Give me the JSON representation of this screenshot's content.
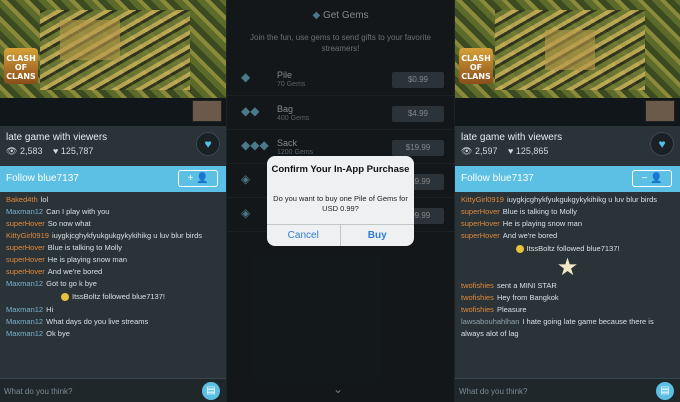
{
  "left": {
    "video_logo": [
      "CLASH",
      "OF",
      "CLANS"
    ],
    "stream_title": "late game with viewers",
    "views": "2,583",
    "likes": "125,787",
    "follow_label": "Follow blue7137",
    "follow_button": "+ 👤",
    "chat": [
      {
        "type": "msg",
        "user": "Baked4th",
        "text": "lol",
        "color": "orange"
      },
      {
        "type": "msg",
        "user": "Maxman12",
        "text": "Can I play with you",
        "color": "blue"
      },
      {
        "type": "msg",
        "user": "superHover",
        "text": "So now what",
        "color": "orange"
      },
      {
        "type": "msg",
        "user": "KittyGirl0919",
        "text": "iuygkjcghykfyukgukgykykihikg u luv blur birds",
        "color": "orange"
      },
      {
        "type": "msg",
        "user": "superHover",
        "text": "Blue is talking to Molly",
        "color": "orange"
      },
      {
        "type": "msg",
        "user": "superHover",
        "text": "He is playing snow man",
        "color": "orange"
      },
      {
        "type": "msg",
        "user": "superHover",
        "text": "And we're bored",
        "color": "orange"
      },
      {
        "type": "msg",
        "user": "Maxman12",
        "text": "Got to go k bye",
        "color": "blue"
      },
      {
        "type": "event",
        "text": "ItssBoltz followed blue7137!"
      },
      {
        "type": "msg",
        "user": "Maxman12",
        "text": "Hi",
        "color": "blue"
      },
      {
        "type": "msg",
        "user": "Maxman12",
        "text": "What days do you live streams",
        "color": "blue"
      },
      {
        "type": "msg",
        "user": "Maxman12",
        "text": "Ok bye",
        "color": "blue"
      }
    ],
    "input_placeholder": "What do you think?"
  },
  "middle": {
    "header": "Get Gems",
    "subtitle": "Join the fun, use gems to send gifts to your favorite streamers!",
    "gems": [
      {
        "name": "Pile",
        "count": "70 Gems",
        "price": "$0.99"
      },
      {
        "name": "Bag",
        "count": "400 Gems",
        "price": "$4.99"
      },
      {
        "name": "Sack",
        "count": "1200 Gems",
        "price": "$19.99"
      },
      {
        "name": "",
        "count": "",
        "price": "$39.99"
      },
      {
        "name": "",
        "count": "",
        "price": "$99.99"
      }
    ],
    "dialog": {
      "title": "Confirm Your In-App Purchase",
      "message": "Do you want to buy one Pile of Gems for USD 0.99?",
      "cancel": "Cancel",
      "buy": "Buy"
    }
  },
  "right": {
    "video_logo": [
      "CLASH",
      "OF",
      "CLANS"
    ],
    "stream_title": "late game with viewers",
    "views": "2,597",
    "likes": "125,865",
    "follow_label": "Follow blue7137",
    "follow_button": "− 👤",
    "chat": [
      {
        "type": "msg",
        "user": "KittyGirl0919",
        "text": "iuygkjcghykfyukgukgykykihikg u luv blur birds",
        "color": "orange"
      },
      {
        "type": "msg",
        "user": "superHover",
        "text": "Blue is talking to Molly",
        "color": "orange"
      },
      {
        "type": "msg",
        "user": "superHover",
        "text": "He is playing snow man",
        "color": "orange"
      },
      {
        "type": "msg",
        "user": "superHover",
        "text": "And we're bored",
        "color": "orange"
      },
      {
        "type": "event",
        "text": "ItssBoltz followed blue7137!"
      },
      {
        "type": "star"
      },
      {
        "type": "msg",
        "user": "twofishies",
        "text": "sent a MINI STAR",
        "color": "orange"
      },
      {
        "type": "msg",
        "user": "twofishies",
        "text": "Hey from Bangkok",
        "color": "orange"
      },
      {
        "type": "msg",
        "user": "twofishies",
        "text": "Pleasure",
        "color": "orange"
      },
      {
        "type": "msg",
        "user": "lawsabouhahlhan",
        "text": "I hate going late game because there is always alot of lag",
        "color": "grey"
      }
    ],
    "input_placeholder": "What do you think?"
  },
  "colors": {
    "accent": "#5bc0e3",
    "panel": "#2a3338",
    "username_orange": "#e08a3c",
    "username_blue": "#7ab3cf"
  }
}
